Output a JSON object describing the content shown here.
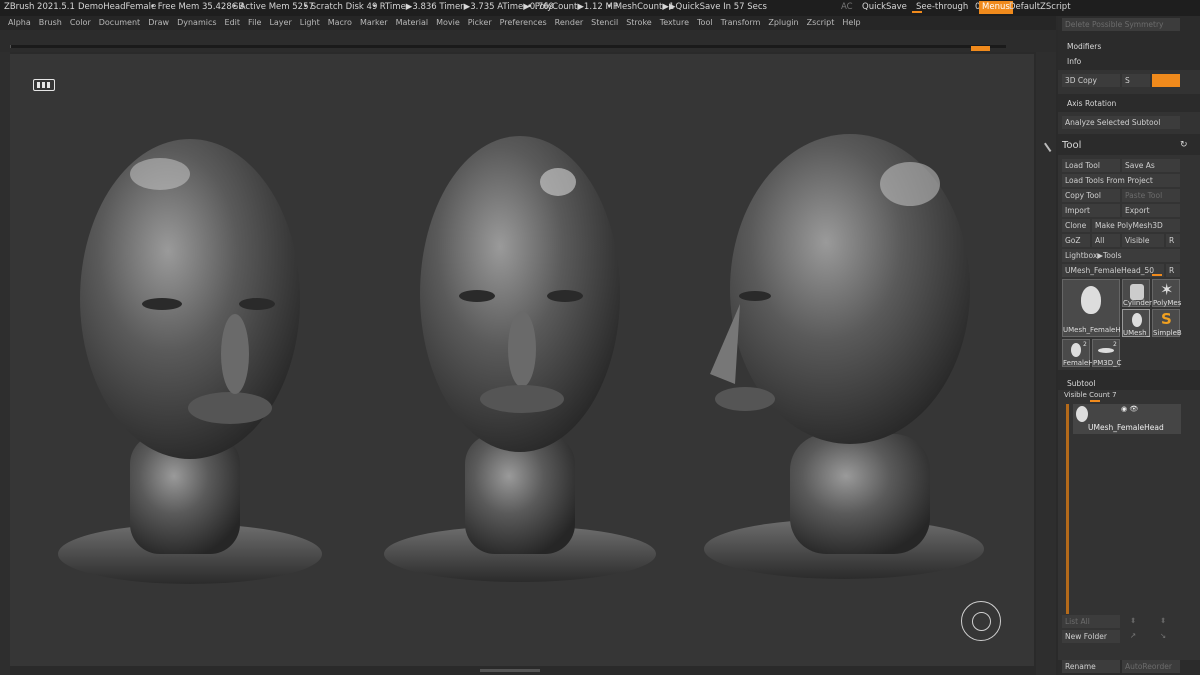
{
  "titlebar": {
    "app": "ZBrush 2021.5.1",
    "document": "DemoHeadFemale",
    "free_mem": "• Free Mem 35.428GB",
    "active_mem": "• Active Mem 5257",
    "scratch": "• Scratch Disk 49",
    "timers": "• RTime▶3.836 Timer▶3.735 ATime▶0.769",
    "polycount": "• PolyCount▶1.12 MP",
    "meshcount": "• MeshCount▶1",
    "quicksave_timer": "▶QuickSave In 57 Secs",
    "ac": "AC",
    "quicksave": "QuickSave",
    "seethrough": "See-through",
    "seethrough_value": "0",
    "menus": "Menus",
    "script": "DefaultZScript"
  },
  "menus": [
    "Alpha",
    "Brush",
    "Color",
    "Document",
    "Draw",
    "Dynamics",
    "Edit",
    "File",
    "Layer",
    "Light",
    "Macro",
    "Marker",
    "Material",
    "Movie",
    "Picker",
    "Preferences",
    "Render",
    "Stencil",
    "Stroke",
    "Texture",
    "Tool",
    "Transform",
    "Zplugin",
    "Zscript",
    "Help"
  ],
  "panel": {
    "delete_symmetry": "Delete Possible Symmetry",
    "modifiers": "Modifiers",
    "info": "Info",
    "copy3d": "3D Copy",
    "copy3d_value": "S",
    "axis_rotation": "Axis Rotation",
    "analyze_subtool": "Analyze Selected Subtool",
    "tool_title": "Tool",
    "load_tool": "Load Tool",
    "save_as": "Save As",
    "load_from_project": "Load Tools From Project",
    "copy_tool": "Copy Tool",
    "paste_tool": "Paste Tool",
    "import": "Import",
    "export": "Export",
    "clone": "Clone",
    "make_polymesh": "Make PolyMesh3D",
    "goz": "GoZ",
    "all": "All",
    "visible": "Visible",
    "r": "R",
    "lightbox_tools": "Lightbox▶Tools",
    "current_tool": "UMesh_FemaleHead_50",
    "current_tool_r": "R",
    "thumb_main": "UMesh_FemaleH",
    "thumb_cylinder": "Cylinder",
    "thumb_polymesh": "PolyMes",
    "thumb_umesh": "UMesh_",
    "thumb_simpleb": "SimpleB",
    "thumb_female": "FemaleH",
    "thumb_pm3d": "PM3D_C",
    "thumb_count_a": "2",
    "thumb_count_b": "2",
    "subtool": "Subtool",
    "visible_count": "Visible Count 7",
    "subtool_name": "UMesh_FemaleHead",
    "list_all": "List All",
    "new_folder": "New Folder",
    "rename": "Rename",
    "auto_reorder": "AutoReorder"
  },
  "colors": {
    "accent": "#f08a1c",
    "canvas": "#363636",
    "panel": "#2b2b2b"
  }
}
